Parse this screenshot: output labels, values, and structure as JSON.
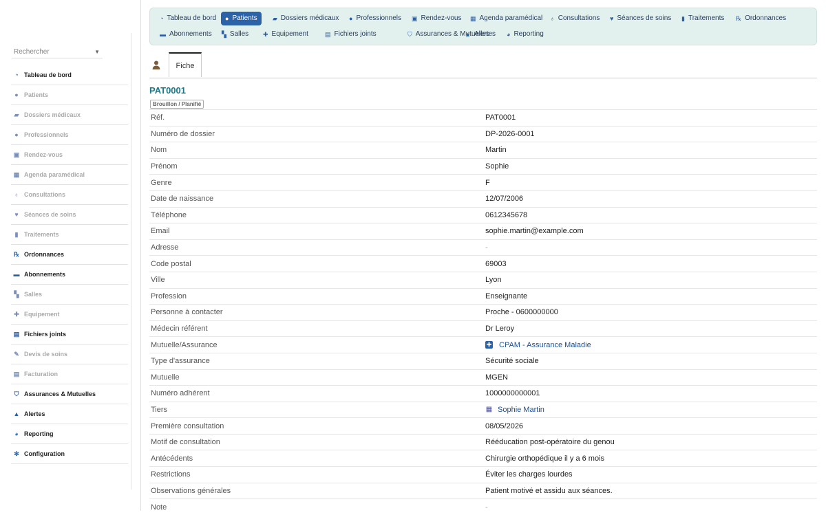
{
  "sidebar": {
    "search_placeholder": "Rechercher",
    "items": [
      {
        "label": "Tableau de bord",
        "icon": "dashboard-icon",
        "glyph": "◔",
        "active": true
      },
      {
        "label": "Patients",
        "icon": "user-icon",
        "glyph": "●",
        "active": false
      },
      {
        "label": "Dossiers médicaux",
        "icon": "folder-icon",
        "glyph": "▰",
        "active": false
      },
      {
        "label": "Professionnels",
        "icon": "user-icon",
        "glyph": "●",
        "active": false
      },
      {
        "label": "Rendez-vous",
        "icon": "calendar-check-icon",
        "glyph": "▣",
        "active": false
      },
      {
        "label": "Agenda paramédical",
        "icon": "calendar-icon",
        "glyph": "▦",
        "active": false
      },
      {
        "label": "Consultations",
        "icon": "stethoscope-icon",
        "glyph": "♁",
        "active": false
      },
      {
        "label": "Séances de soins",
        "icon": "heart-icon",
        "glyph": "♥",
        "active": false
      },
      {
        "label": "Traitements",
        "icon": "prescription-bottle-icon",
        "glyph": "▮",
        "active": false
      },
      {
        "label": "Ordonnances",
        "icon": "prescription-icon",
        "glyph": "℞",
        "active": true
      },
      {
        "label": "Abonnements",
        "icon": "card-icon",
        "glyph": "▬",
        "active": true
      },
      {
        "label": "Salles",
        "icon": "door-icon",
        "glyph": "▚",
        "active": false
      },
      {
        "label": "Equipement",
        "icon": "medkit-icon",
        "glyph": "✚",
        "active": false
      },
      {
        "label": "Fichiers joints",
        "icon": "file-icon",
        "glyph": "▤",
        "active": true
      },
      {
        "label": "Devis de soins",
        "icon": "file-edit-icon",
        "glyph": "✎",
        "active": false
      },
      {
        "label": "Facturation",
        "icon": "invoice-icon",
        "glyph": "▤",
        "active": false
      },
      {
        "label": "Assurances & Mutuelles",
        "icon": "shield-icon",
        "glyph": "⛉",
        "active": true
      },
      {
        "label": "Alertes",
        "icon": "warning-icon",
        "glyph": "▲",
        "active": true
      },
      {
        "label": "Reporting",
        "icon": "pie-chart-icon",
        "glyph": "◕",
        "active": true
      },
      {
        "label": "Configuration",
        "icon": "gear-icon",
        "glyph": "✻",
        "active": true
      }
    ]
  },
  "topnav": [
    {
      "label": "Tableau de bord",
      "icon": "dashboard-icon",
      "glyph": "◔",
      "active": false
    },
    {
      "label": "Patients",
      "icon": "user-icon",
      "glyph": "●",
      "active": true
    },
    {
      "label": "Dossiers médicaux",
      "icon": "folder-icon",
      "glyph": "▰",
      "active": false
    },
    {
      "label": "Professionnels",
      "icon": "user-icon",
      "glyph": "●",
      "active": false
    },
    {
      "label": "Rendez-vous",
      "icon": "calendar-check-icon",
      "glyph": "▣",
      "active": false
    },
    {
      "label": "Agenda paramédical",
      "icon": "calendar-icon",
      "glyph": "▦",
      "active": false
    },
    {
      "label": "Consultations",
      "icon": "stethoscope-icon",
      "glyph": "♁",
      "active": false
    },
    {
      "label": "Séances de soins",
      "icon": "heart-icon",
      "glyph": "♥",
      "active": false
    },
    {
      "label": "Traitements",
      "icon": "prescription-bottle-icon",
      "glyph": "▮",
      "active": false
    },
    {
      "label": "Ordonnances",
      "icon": "prescription-icon",
      "glyph": "℞",
      "active": false
    },
    {
      "label": "Abonnements",
      "icon": "card-icon",
      "glyph": "▬",
      "active": false
    },
    {
      "label": "Salles",
      "icon": "door-icon",
      "glyph": "▚",
      "active": false
    },
    {
      "label": "Equipement",
      "icon": "medkit-icon",
      "glyph": "✚",
      "active": false
    },
    {
      "label": "Fichiers joints",
      "icon": "file-icon",
      "glyph": "▤",
      "active": false
    },
    {
      "label": "Assurances & Mutuelles",
      "icon": "shield-icon",
      "glyph": "⛉",
      "active": false
    },
    {
      "label": "Alertes",
      "icon": "warning-icon",
      "glyph": "▲",
      "active": false
    },
    {
      "label": "Reporting",
      "icon": "pie-chart-icon",
      "glyph": "◕",
      "active": false
    }
  ],
  "tabs": {
    "fiche_label": "Fiche"
  },
  "record": {
    "ref": "PAT0001",
    "status": "Brouillon / Planifié",
    "fields": [
      {
        "label": "Réf.",
        "value": "PAT0001"
      },
      {
        "label": "Numéro de dossier",
        "value": "DP-2026-0001"
      },
      {
        "label": "Nom",
        "value": "Martin"
      },
      {
        "label": "Prénom",
        "value": "Sophie"
      },
      {
        "label": "Genre",
        "value": "F"
      },
      {
        "label": "Date de naissance",
        "value": "12/07/2006"
      },
      {
        "label": "Téléphone",
        "value": "0612345678"
      },
      {
        "label": "Email",
        "value": "sophie.martin@example.com"
      },
      {
        "label": "Adresse",
        "value": "-",
        "empty": true
      },
      {
        "label": "Code postal",
        "value": "69003"
      },
      {
        "label": "Ville",
        "value": "Lyon"
      },
      {
        "label": "Profession",
        "value": "Enseignante"
      },
      {
        "label": "Personne à contacter",
        "value": "Proche - 0600000000"
      },
      {
        "label": "Médecin référent",
        "value": "Dr Leroy"
      },
      {
        "label": "Mutuelle/Assurance",
        "value": "CPAM - Assurance Maladie",
        "link": "plus"
      },
      {
        "label": "Type d'assurance",
        "value": "Sécurité sociale"
      },
      {
        "label": "Mutuelle",
        "value": "MGEN"
      },
      {
        "label": "Numéro adhérent",
        "value": "1000000000001"
      },
      {
        "label": "Tiers",
        "value": "Sophie Martin",
        "link": "bldg"
      },
      {
        "label": "Première consultation",
        "value": "08/05/2026"
      },
      {
        "label": "Motif de consultation",
        "value": "Rééducation post-opératoire du genou"
      },
      {
        "label": "Antécédents",
        "value": "Chirurgie orthopédique il y a 6 mois"
      },
      {
        "label": "Restrictions",
        "value": "Éviter les charges lourdes"
      },
      {
        "label": "Observations générales",
        "value": "Patient motivé et assidu aux séances."
      },
      {
        "label": "Note",
        "value": "-",
        "empty": true
      }
    ]
  }
}
